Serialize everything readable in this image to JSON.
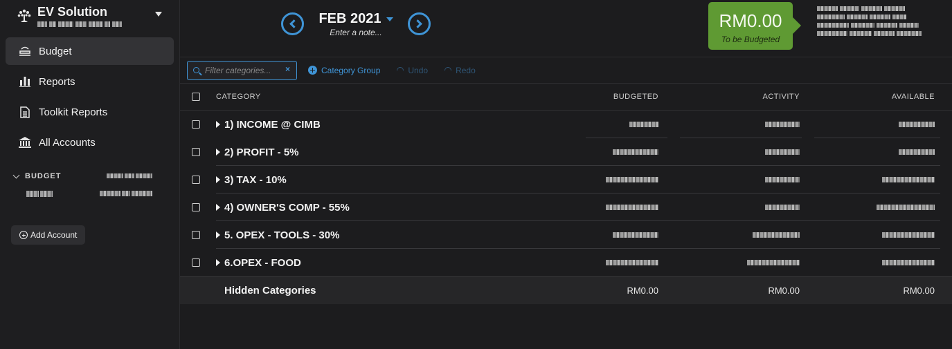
{
  "sidebar": {
    "brand_name": "EV Solution",
    "nav": [
      {
        "label": "Budget",
        "icon": "budget-icon",
        "active": true
      },
      {
        "label": "Reports",
        "icon": "bar-chart-icon"
      },
      {
        "label": "Toolkit Reports",
        "icon": "document-icon"
      },
      {
        "label": "All Accounts",
        "icon": "bank-icon"
      }
    ],
    "account_group_label": "BUDGET",
    "add_account_label": "Add Account"
  },
  "header": {
    "month": "FEB 2021",
    "note_placeholder": "Enter a note...",
    "to_be_budgeted_amount": "RM0.00",
    "to_be_budgeted_label": "To be Budgeted",
    "accent_color": "#3f94d6",
    "tbb_color": "#5f9a33"
  },
  "toolbar": {
    "filter_placeholder": "Filter categories...",
    "clear_symbol": "×",
    "category_group_label": "Category Group",
    "undo_label": "Undo",
    "redo_label": "Redo"
  },
  "table": {
    "columns": {
      "category": "CATEGORY",
      "budgeted": "BUDGETED",
      "activity": "ACTIVITY",
      "available": "AVAILABLE"
    },
    "groups": [
      {
        "name": "1) INCOME @ CIMB"
      },
      {
        "name": "2) PROFIT - 5%"
      },
      {
        "name": "3) TAX - 10%"
      },
      {
        "name": "4) OWNER'S COMP - 55%"
      },
      {
        "name": "5. OPEX - TOOLS - 30%"
      },
      {
        "name": "6.OPEX - FOOD"
      }
    ],
    "hidden": {
      "label": "Hidden Categories",
      "budgeted": "RM0.00",
      "activity": "RM0.00",
      "available": "RM0.00"
    }
  }
}
